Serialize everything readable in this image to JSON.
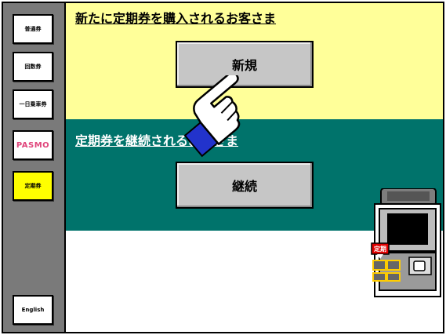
{
  "sidebar": {
    "items": [
      {
        "label": "普通券"
      },
      {
        "label": "回数券"
      },
      {
        "label": "一日乗車券"
      },
      {
        "label": "PASMO"
      },
      {
        "label": "定期券"
      },
      {
        "label": "English"
      }
    ]
  },
  "main": {
    "new_section": {
      "heading": "新たに定期券を購入されるお客さま",
      "button_label": "新規"
    },
    "renew_section": {
      "heading": "定期券を継続されるお客さま",
      "button_label": "継続"
    },
    "machine_tag": "定期"
  },
  "colors": {
    "new_section_bg": "#ffff99",
    "renew_section_bg": "#00736b",
    "sidebar_bg": "#7a7a7a",
    "active_item_bg": "#ffff00",
    "button_bg": "#c6c6c6",
    "pasmo_pink": "#e0457b"
  },
  "icons": {
    "pointer": "pointing-hand-icon",
    "machine": "ticket-machine-icon"
  }
}
